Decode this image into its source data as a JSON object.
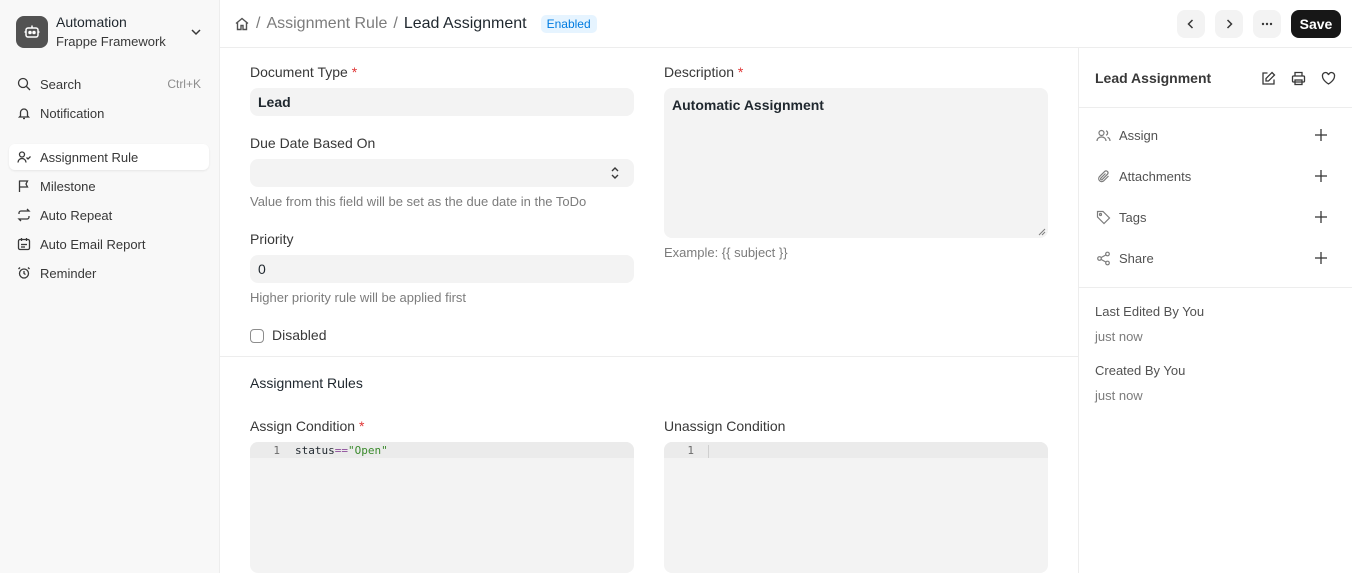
{
  "workspace": {
    "title": "Automation",
    "subtitle": "Frappe Framework",
    "logo_icon": "robot-icon"
  },
  "sidebar": {
    "search": {
      "label": "Search",
      "shortcut": "Ctrl+K"
    },
    "notification": {
      "label": "Notification"
    },
    "items": [
      {
        "label": "Assignment Rule",
        "icon": "user-assign-icon",
        "active": true
      },
      {
        "label": "Milestone",
        "icon": "flag-icon"
      },
      {
        "label": "Auto Repeat",
        "icon": "repeat-icon"
      },
      {
        "label": "Auto Email Report",
        "icon": "calendar-report-icon"
      },
      {
        "label": "Reminder",
        "icon": "alarm-icon"
      }
    ]
  },
  "breadcrumb": {
    "parent": "Assignment Rule",
    "current": "Lead Assignment",
    "status": "Enabled"
  },
  "toolbar": {
    "save_label": "Save"
  },
  "form": {
    "document_type": {
      "label": "Document Type",
      "value": "Lead",
      "required": "*"
    },
    "description": {
      "label": "Description",
      "value": "Automatic Assignment",
      "required": "*",
      "help": "Example: {{ subject }}"
    },
    "due_date": {
      "label": "Due Date Based On",
      "value": "",
      "help": "Value from this field will be set as the due date in the ToDo"
    },
    "priority": {
      "label": "Priority",
      "value": "0",
      "help": "Higher priority rule will be applied first"
    },
    "disabled": {
      "label": "Disabled",
      "checked": false
    },
    "section_title": "Assignment Rules",
    "assign_condition": {
      "label": "Assign Condition",
      "required": "*",
      "line_no": "1",
      "code_var": "status",
      "code_op": "==",
      "code_str": "\"Open\""
    },
    "unassign_condition": {
      "label": "Unassign Condition",
      "line_no": "1"
    }
  },
  "right_panel": {
    "title": "Lead Assignment",
    "actions": [
      {
        "label": "Assign",
        "icon": "users-icon"
      },
      {
        "label": "Attachments",
        "icon": "paperclip-icon"
      },
      {
        "label": "Tags",
        "icon": "tag-icon"
      },
      {
        "label": "Share",
        "icon": "share-icon"
      }
    ],
    "last_edited": "Last Edited By You",
    "last_edited_time": "just now",
    "created": "Created By You",
    "created_time": "just now"
  },
  "colors": {
    "primary_dark": "#171717",
    "status_blue": "#007be0",
    "required_red": "#e03636"
  }
}
